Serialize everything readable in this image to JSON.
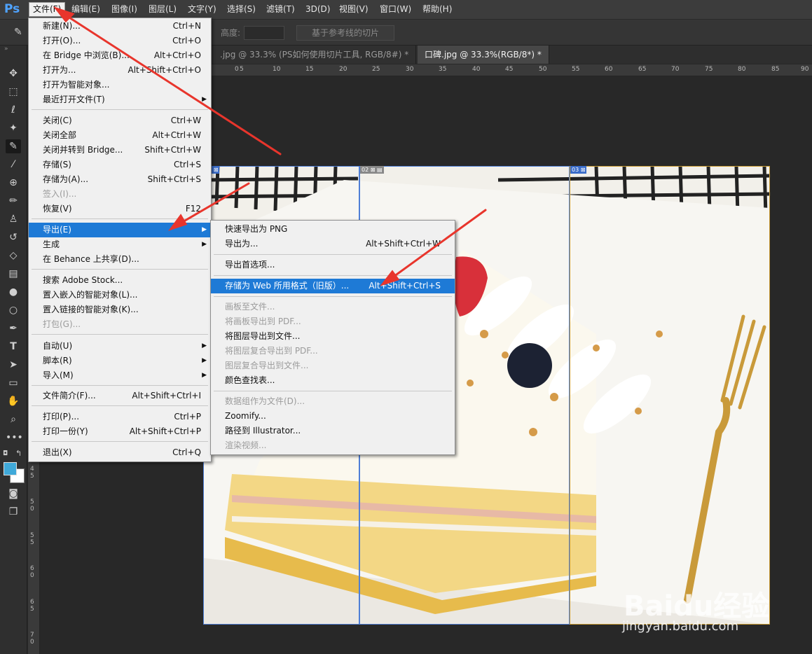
{
  "menubar": {
    "items": [
      "文件(F)",
      "编辑(E)",
      "图像(I)",
      "图层(L)",
      "文字(Y)",
      "选择(S)",
      "滤镜(T)",
      "3D(D)",
      "视图(V)",
      "窗口(W)",
      "帮助(H)"
    ],
    "active_index": 0
  },
  "options": {
    "height_label": "高度:",
    "guide_slices_button": "基于参考线的切片"
  },
  "tabs": [
    ".jpg @ 33.3% (PS如何使用切片工具, RGB/8#) *",
    "口碑.jpg @ 33.3%(RGB/8*) *"
  ],
  "ruler": {
    "h_ticks": [
      "0",
      "5",
      "10",
      "15",
      "20",
      "25",
      "30",
      "35",
      "40",
      "45",
      "50",
      "55",
      "60",
      "65",
      "70",
      "75",
      "80",
      "85",
      "90"
    ],
    "v_ticks": [
      "45",
      "50",
      "55",
      "60",
      "65",
      "70"
    ]
  },
  "slices": {
    "s01": "01",
    "s02": "02",
    "s03": "03"
  },
  "file_menu": {
    "items": [
      {
        "label": "新建(N)...",
        "shortcut": "Ctrl+N"
      },
      {
        "label": "打开(O)...",
        "shortcut": "Ctrl+O"
      },
      {
        "label": "在 Bridge 中浏览(B)...",
        "shortcut": "Alt+Ctrl+O"
      },
      {
        "label": "打开为...",
        "shortcut": "Alt+Shift+Ctrl+O"
      },
      {
        "label": "打开为智能对象...",
        "shortcut": ""
      },
      {
        "label": "最近打开文件(T)",
        "shortcut": ""
      },
      {
        "label": "关闭(C)",
        "shortcut": "Ctrl+W"
      },
      {
        "label": "关闭全部",
        "shortcut": "Alt+Ctrl+W"
      },
      {
        "label": "关闭并转到 Bridge...",
        "shortcut": "Shift+Ctrl+W"
      },
      {
        "label": "存储(S)",
        "shortcut": "Ctrl+S"
      },
      {
        "label": "存储为(A)...",
        "shortcut": "Shift+Ctrl+S"
      },
      {
        "label": "签入(I)...",
        "shortcut": ""
      },
      {
        "label": "恢复(V)",
        "shortcut": "F12"
      },
      {
        "label": "导出(E)",
        "shortcut": ""
      },
      {
        "label": "生成",
        "shortcut": ""
      },
      {
        "label": "在 Behance 上共享(D)...",
        "shortcut": ""
      },
      {
        "label": "搜索 Adobe Stock...",
        "shortcut": ""
      },
      {
        "label": "置入嵌入的智能对象(L)...",
        "shortcut": ""
      },
      {
        "label": "置入链接的智能对象(K)...",
        "shortcut": ""
      },
      {
        "label": "打包(G)...",
        "shortcut": ""
      },
      {
        "label": "自动(U)",
        "shortcut": ""
      },
      {
        "label": "脚本(R)",
        "shortcut": ""
      },
      {
        "label": "导入(M)",
        "shortcut": ""
      },
      {
        "label": "文件简介(F)...",
        "shortcut": "Alt+Shift+Ctrl+I"
      },
      {
        "label": "打印(P)...",
        "shortcut": "Ctrl+P"
      },
      {
        "label": "打印一份(Y)",
        "shortcut": "Alt+Shift+Ctrl+P"
      },
      {
        "label": "退出(X)",
        "shortcut": "Ctrl+Q"
      }
    ]
  },
  "export_menu": {
    "items": [
      {
        "label": "快速导出为 PNG",
        "shortcut": ""
      },
      {
        "label": "导出为...",
        "shortcut": "Alt+Shift+Ctrl+W"
      },
      {
        "label": "导出首选项...",
        "shortcut": ""
      },
      {
        "label": "存储为 Web 所用格式（旧版）...",
        "shortcut": "Alt+Shift+Ctrl+S"
      },
      {
        "label": "画板至文件...",
        "shortcut": ""
      },
      {
        "label": "将画板导出到 PDF...",
        "shortcut": ""
      },
      {
        "label": "将图层导出到文件...",
        "shortcut": ""
      },
      {
        "label": "将图层复合导出到 PDF...",
        "shortcut": ""
      },
      {
        "label": "图层复合导出到文件...",
        "shortcut": ""
      },
      {
        "label": "颜色查找表...",
        "shortcut": ""
      },
      {
        "label": "数据组作为文件(D)...",
        "shortcut": ""
      },
      {
        "label": "Zoomify...",
        "shortcut": ""
      },
      {
        "label": "路径到 Illustrator...",
        "shortcut": ""
      },
      {
        "label": "渲染视频...",
        "shortcut": ""
      }
    ]
  },
  "watermark": {
    "logo": "Baidu经验",
    "url": "jingyan.baidu.com"
  },
  "colors": {
    "accent": "#1e7ad6",
    "annotation_arrow": "#e8352c",
    "foreground_swatch": "#3fa9d9",
    "background_swatch": "#ffffff"
  }
}
